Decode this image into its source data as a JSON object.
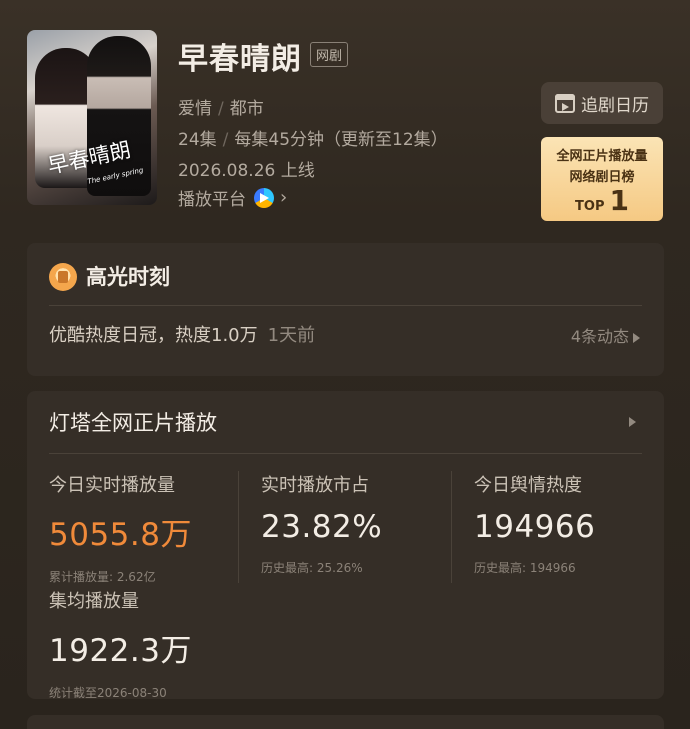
{
  "show": {
    "title": "早春晴朗",
    "tag": "网剧",
    "genres": [
      "爱情",
      "都市"
    ],
    "episodes": "24集",
    "episode_length": "每集45分钟（更新至12集）",
    "release": "2026.08.26 上线",
    "platform_label": "播放平台",
    "poster_title": "早春晴朗",
    "poster_sub": "The early spring"
  },
  "calendar_button": {
    "label": "追剧日历"
  },
  "rank_badge": {
    "line1": "全网正片播放量",
    "line2": "网络剧日榜",
    "top_label": "TOP",
    "top_num": "1"
  },
  "highlight": {
    "title": "高光时刻",
    "text": "优酷热度日冠，热度1.0万",
    "ago": "1天前",
    "more": "4条动态"
  },
  "stats": {
    "title": "灯塔全网正片播放",
    "today_label": "今日实时播放量",
    "today_value": "5055.8万",
    "today_sub": "累计播放量: 2.62亿",
    "share_label": "实时播放市占",
    "share_value": "23.82%",
    "share_sub": "历史最高: 25.26%",
    "heat_label": "今日舆情热度",
    "heat_value": "194966",
    "heat_sub": "历史最高: 194966",
    "avg_label": "集均播放量",
    "avg_value": "1922.3万",
    "avg_sub": "统计截至2026-08-30"
  },
  "colors": {
    "accent": "#f08a3a",
    "badge": "#f5c983",
    "card": "#352e27"
  }
}
